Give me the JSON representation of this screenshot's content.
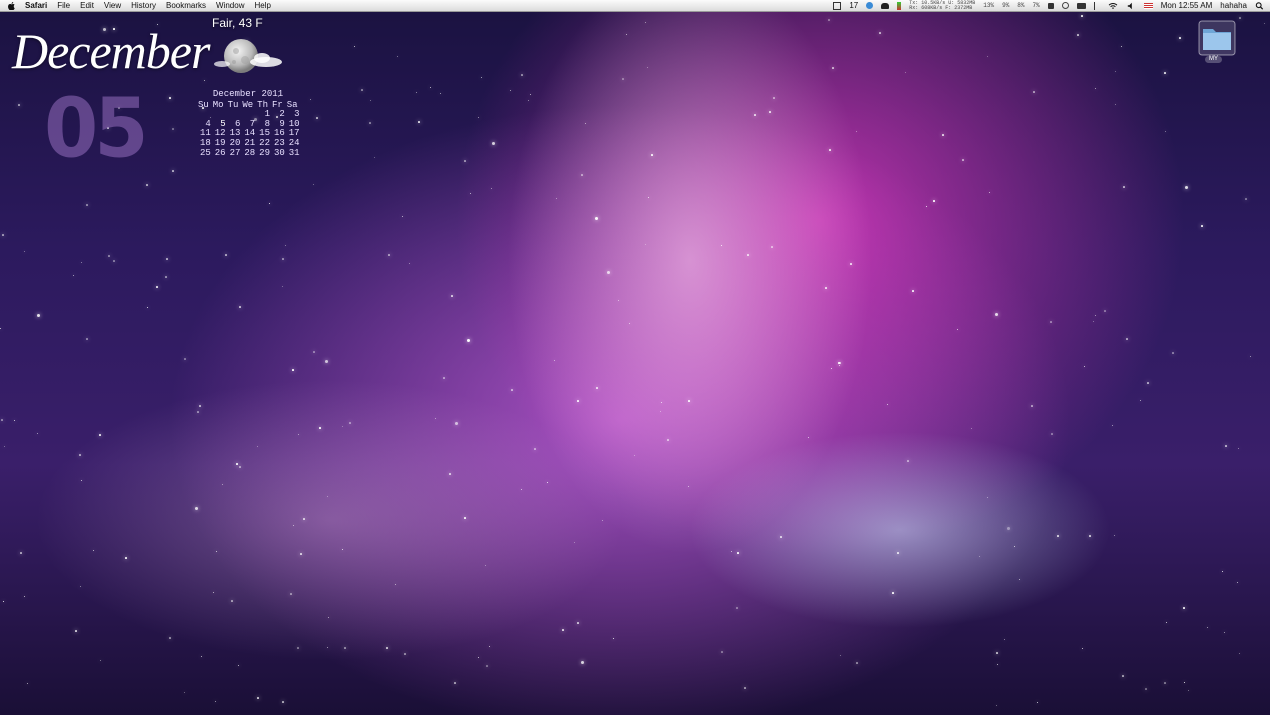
{
  "menubar": {
    "app_name": "Safari",
    "menus": [
      "File",
      "Edit",
      "View",
      "History",
      "Bookmarks",
      "Window",
      "Help"
    ],
    "status": {
      "badge_count": "17",
      "net_line1": "Tx: 10.5KB/s  U: 5832MB",
      "net_line2": "Rx: 608KB/s  F: 2372MB",
      "cpu": "13%",
      "mem": "9%",
      "disk": "8%",
      "battery": "7%",
      "clock": "Mon 12:55 AM",
      "user": "hahaha"
    }
  },
  "desktop": {
    "month_script": "December",
    "day_big": "05",
    "weather": "Fair, 43 F",
    "calendar": {
      "title": "December 2011",
      "headers": [
        "Su",
        "Mo",
        "Tu",
        "We",
        "Th",
        "Fr",
        "Sa"
      ],
      "weeks": [
        [
          "",
          "",
          "",
          "",
          "1",
          "2",
          "3"
        ],
        [
          "4",
          "5",
          "6",
          "7",
          "8",
          "9",
          "10"
        ],
        [
          "11",
          "12",
          "13",
          "14",
          "15",
          "16",
          "17"
        ],
        [
          "18",
          "19",
          "20",
          "21",
          "22",
          "23",
          "24"
        ],
        [
          "25",
          "26",
          "27",
          "28",
          "29",
          "30",
          "31"
        ]
      ]
    },
    "folder_label": "MY"
  },
  "icons": {
    "apple": "apple-icon",
    "weather": "moon-cloud-icon",
    "folder": "folder-icon",
    "search": "spotlight-search-icon",
    "wifi": "wifi-icon",
    "volume": "volume-icon",
    "flag": "us-flag-icon"
  }
}
